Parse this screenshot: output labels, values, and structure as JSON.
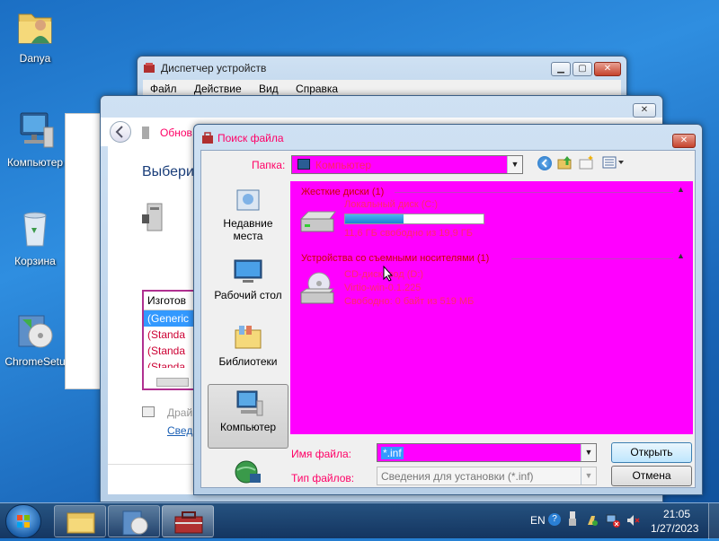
{
  "desktop": {
    "icons": [
      {
        "label": "Danya"
      },
      {
        "label": "Компьютер"
      },
      {
        "label": "Корзина"
      },
      {
        "label": "ChromeSetu"
      }
    ]
  },
  "device_manager": {
    "title": "Диспетчер устройств",
    "menu": [
      "Файл",
      "Действие",
      "Вид",
      "Справка"
    ]
  },
  "wizard": {
    "title_fragment": "Обнов",
    "heading_fragment": "Выберит",
    "list_header_fragment": "Изготов",
    "list_items": [
      "(Generic",
      "(Standa",
      "(Standa",
      "(Standa"
    ],
    "driver_text_fragment": "Драй",
    "link_fragment": "Свед"
  },
  "dialog": {
    "title": "Поиск файла",
    "folder_label": "Папка:",
    "folder_value": "Компьютер",
    "places": [
      {
        "label": "Недавние места"
      },
      {
        "label": "Рабочий стол"
      },
      {
        "label": "Библиотеки"
      },
      {
        "label": "Компьютер"
      },
      {
        "label": ""
      }
    ],
    "groups": [
      {
        "title": "Жесткие диски (1)",
        "items": [
          {
            "name": "Локальный диск (C:)",
            "detail": "11,6 ГБ свободно из 19,9 ГБ",
            "usage": 0.42
          }
        ]
      },
      {
        "title": "Устройства со съемными носителями (1)",
        "items": [
          {
            "name": "CD-дисковод (D:)",
            "line2": "Virtio-win-0.1.225",
            "line3": "Свободно: 0 байт из 519 МБ"
          }
        ]
      }
    ],
    "filename_label": "Имя файла:",
    "filename_value": "*.inf",
    "filetype_label": "Тип файлов:",
    "filetype_value": "Сведения для установки (*.inf)",
    "open_button": "Открыть",
    "cancel_button": "Отмена"
  },
  "taskbar": {
    "lang": "EN",
    "time": "21:05",
    "date": "1/27/2023"
  },
  "colors": {
    "highlight": "#ff00ff",
    "accent_text": "#ff0066"
  }
}
